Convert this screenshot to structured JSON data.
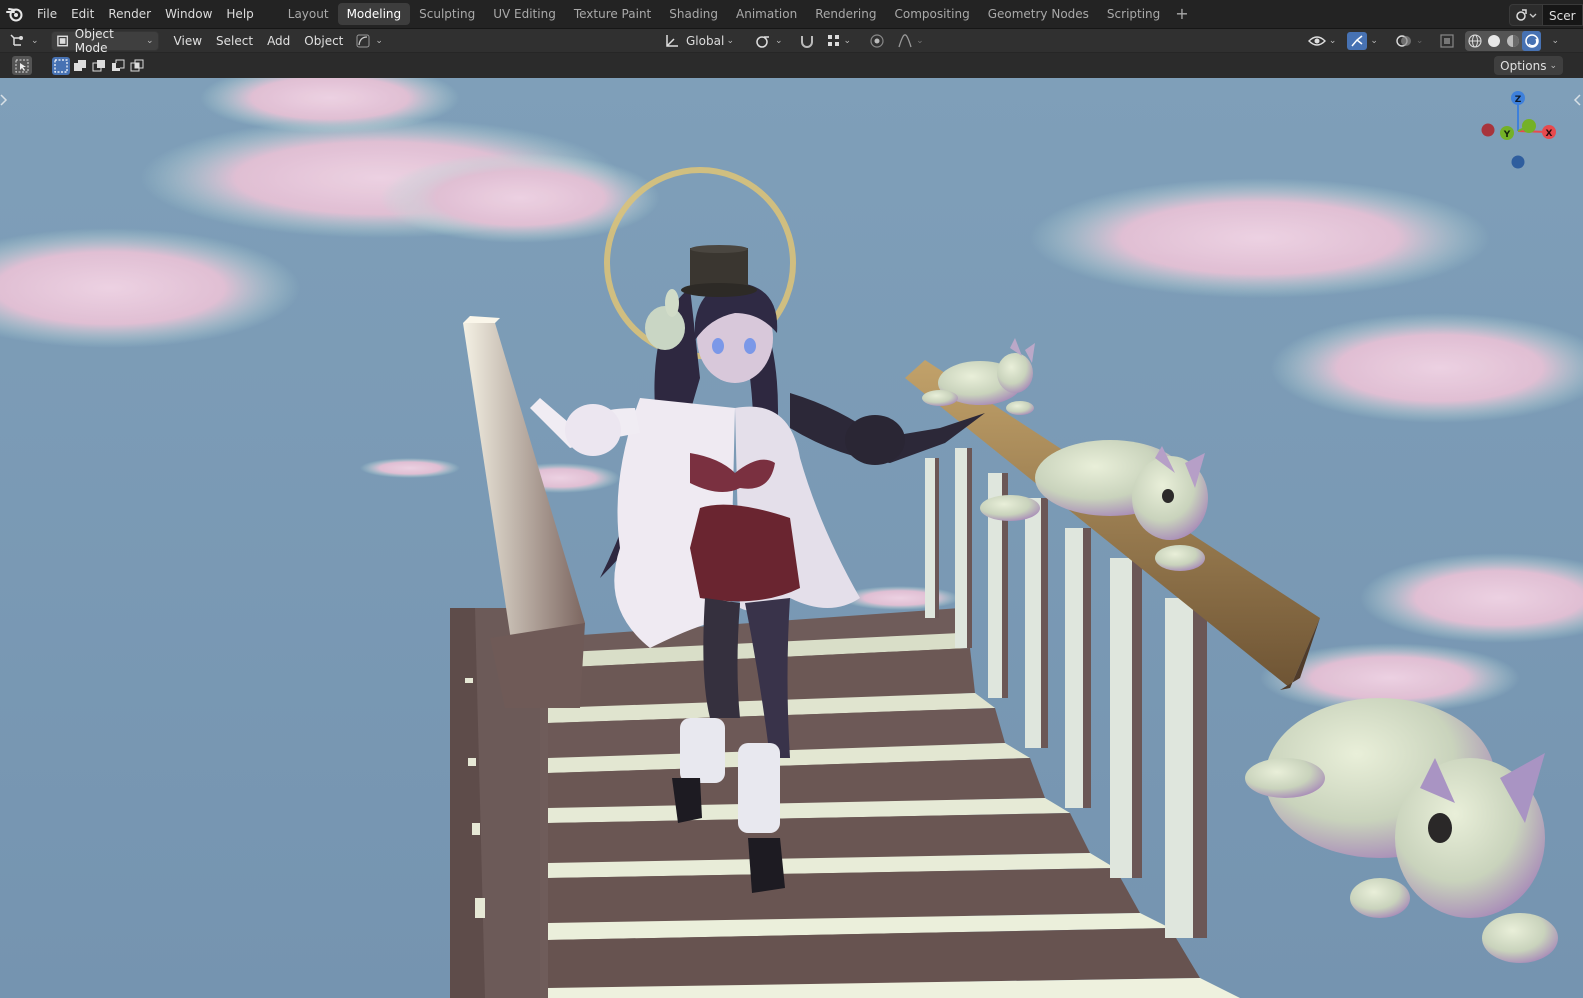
{
  "topbar": {
    "menus": [
      "File",
      "Edit",
      "Render",
      "Window",
      "Help"
    ],
    "workspace_tabs": [
      "Layout",
      "Modeling",
      "Sculpting",
      "UV Editing",
      "Texture Paint",
      "Shading",
      "Animation",
      "Rendering",
      "Compositing",
      "Geometry Nodes",
      "Scripting"
    ],
    "active_tab": "Modeling",
    "add_tab_glyph": "+",
    "scene_label": "Scer"
  },
  "header": {
    "editor_type_icon": "3d-viewport-icon",
    "mode": "Object Mode",
    "menus": [
      "View",
      "Select",
      "Add",
      "Object"
    ],
    "transform_orientation": "Global"
  },
  "toolrow": {
    "options_label": "Options"
  },
  "viewport": {
    "gizmo_axes": [
      "Z",
      "Y",
      "X"
    ],
    "axis_colors": {
      "x": "#e74a4e",
      "y": "#74b126",
      "z": "#3e80db"
    }
  },
  "colors": {
    "accent": "#4772b3",
    "sky": "#7b9bb5",
    "stair_wood": "#6e5a55",
    "step_top": "#e6ead8"
  }
}
